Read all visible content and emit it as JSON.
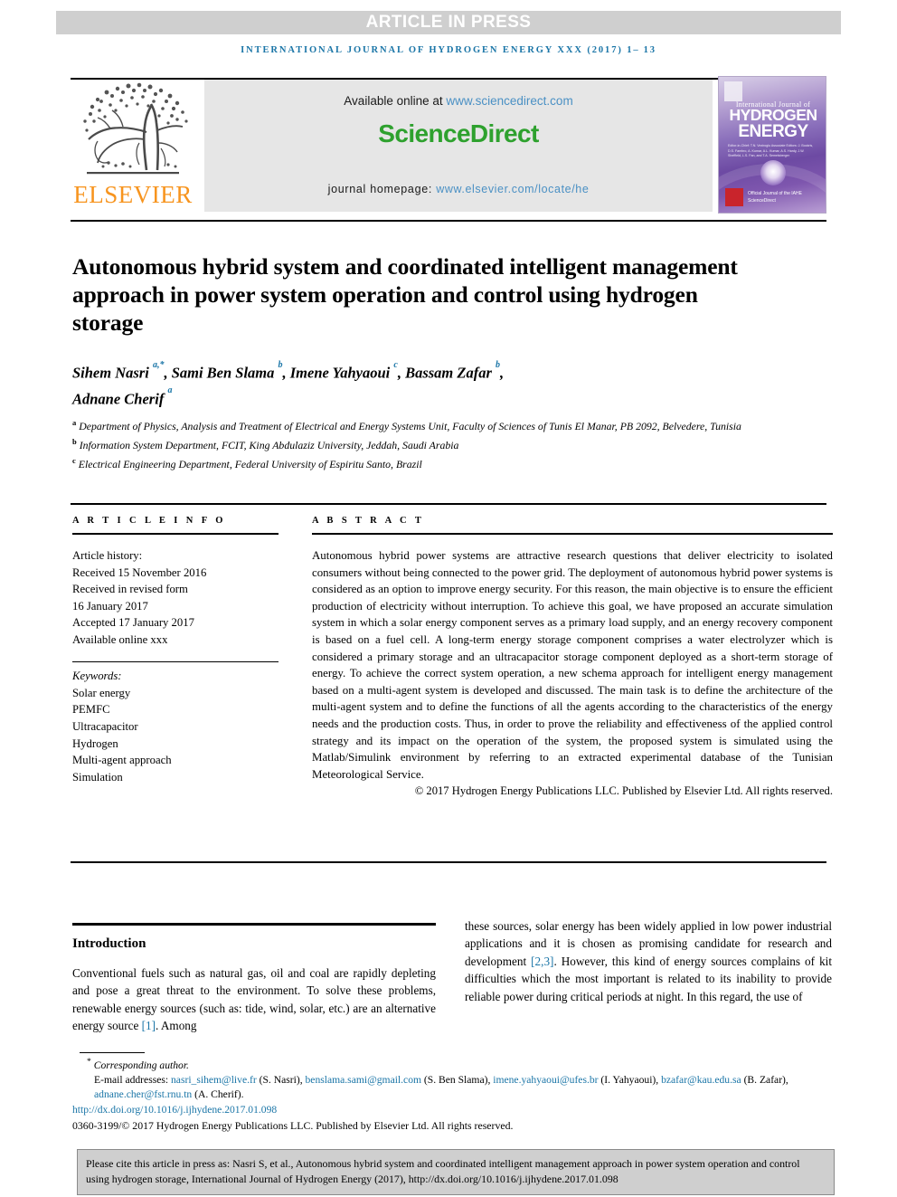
{
  "banner": {
    "text": "ARTICLE IN PRESS"
  },
  "running_head": {
    "text": "INTERNATIONAL JOURNAL OF HYDROGEN ENERGY XXX (2017) 1– 13"
  },
  "masthead": {
    "publisher": "ELSEVIER",
    "available_prefix": "Available online at ",
    "available_url": "www.sciencedirect.com",
    "sciencedirect": "ScienceDirect",
    "homepage_label": "journal homepage: ",
    "homepage_url": "www.elsevier.com/locate/he",
    "cover": {
      "line1": "International Journal of",
      "line2": "HYDROGEN",
      "line3": "ENERGY",
      "editors": "Editor-in-Chief: T.N. Veziroglu    Associate Editors: J. Bockris, D.S. Fambro, A. Kumar, A.L. Kumar, A.S. Hardy, J.W. Sheffield, L.S. Fan, and T.A. Semelsberger",
      "footer": "Official Journal of the IAHE",
      "footer2": "ScienceDirect"
    }
  },
  "article": {
    "title": "Autonomous hybrid system and coordinated intelligent management approach in power system operation and control using hydrogen storage",
    "authors_line1": "Sihem Nasri <sup>a,*</sup>, Sami Ben Slama <sup>b</sup>, Imene Yahyaoui <sup>c</sup>, Bassam Zafar <sup>b</sup>,",
    "authors_line2": "Adnane Cherif <sup>a</sup>",
    "affiliations": [
      {
        "marker": "a",
        "text": "Department of Physics, Analysis and Treatment of Electrical and Energy Systems Unit, Faculty of Sciences of Tunis El Manar, PB 2092, Belvedere, Tunisia"
      },
      {
        "marker": "b",
        "text": "Information System Department, FCIT, King Abdulaziz University, Jeddah, Saudi Arabia"
      },
      {
        "marker": "c",
        "text": "Electrical Engineering Department, Federal University of Espiritu Santo, Brazil"
      }
    ]
  },
  "article_info": {
    "heading": "A R T I C L E  I N F O",
    "history_label": "Article history:",
    "history": [
      "Received 15 November 2016",
      "Received in revised form",
      "16 January 2017",
      "Accepted 17 January 2017",
      "Available online xxx"
    ],
    "keywords_label": "Keywords:",
    "keywords": [
      "Solar energy",
      "PEMFC",
      "Ultracapacitor",
      "Hydrogen",
      "Multi-agent approach",
      "Simulation"
    ]
  },
  "abstract": {
    "heading": "A B S T R A C T",
    "text": "Autonomous hybrid power systems are attractive research questions that deliver electricity to isolated consumers without being connected to the power grid. The deployment of autonomous hybrid power systems is considered as an option to improve energy security. For this reason, the main objective is to ensure the efficient production of electricity without interruption. To achieve this goal, we have proposed an accurate simulation system in which a solar energy component serves as a primary load supply, and an energy recovery component is based on a fuel cell. A long-term energy storage component comprises a water electrolyzer which is considered a primary storage and an ultracapacitor storage component deployed as a short-term storage of energy. To achieve the correct system operation, a new schema approach for intelligent energy management based on a multi-agent system is developed and discussed. The main task is to define the architecture of the multi-agent system and to define the functions of all the agents according to the characteristics of the energy needs and the production costs. Thus, in order to prove the reliability and effectiveness of the applied control strategy and its impact on the operation of the system, the proposed system is simulated using the Matlab/Simulink environment by referring to an extracted experimental database of the Tunisian Meteorological Service.",
    "copyright": "© 2017 Hydrogen Energy Publications LLC. Published by Elsevier Ltd. All rights reserved."
  },
  "body": {
    "intro_heading": "Introduction",
    "left_paragraph_pre": "Conventional fuels such as natural gas, oil and coal are rapidly depleting and pose a great threat to the environment. To solve these problems, renewable energy sources (such as: tide, wind, solar, etc.) are an alternative energy source ",
    "left_ref": "[1]",
    "left_paragraph_post": ". Among",
    "right_paragraph_pre": "these sources, solar energy has been widely applied in low power industrial applications and it is chosen as promising candidate for research and development ",
    "right_ref": "[2,3]",
    "right_paragraph_post": ". However, this kind of energy sources complains of kit difficulties which the most important is related to its inability to provide reliable power during critical periods at night. In this regard, the use of"
  },
  "footnotes": {
    "corresponding": "Corresponding author.",
    "emails_label": "E-mail addresses: ",
    "emails": [
      {
        "address": "nasri_sihem@live.fr",
        "name": " (S. Nasri), "
      },
      {
        "address": "benslama.sami@gmail.com",
        "name": " (S. Ben Slama), "
      },
      {
        "address": "imene.yahyaoui@ufes.br",
        "name": " (I. Yahyaoui), "
      },
      {
        "address": "bzafar@kau.edu.sa",
        "name": " (B. Zafar), "
      },
      {
        "address": "adnane.cher@fst.rnu.tn",
        "name": " (A. Cherif)."
      }
    ],
    "doi": "http://dx.doi.org/10.1016/j.ijhydene.2017.01.098",
    "issn": "0360-3199/© 2017 Hydrogen Energy Publications LLC. Published by Elsevier Ltd. All rights reserved."
  },
  "cite_box": {
    "text": "Please cite this article in press as: Nasri S, et al., Autonomous hybrid system and coordinated intelligent management approach in power system operation and control using hydrogen storage, International Journal of Hydrogen Energy (2017), http://dx.doi.org/10.1016/j.ijhydene.2017.01.098"
  },
  "colors": {
    "banner_bg": "#cfcfcf",
    "link": "#1a75a7",
    "sciencedirect_green": "#2ea12e",
    "elsevier_orange": "#f7941e",
    "cite_bg": "#cfcfcf"
  }
}
